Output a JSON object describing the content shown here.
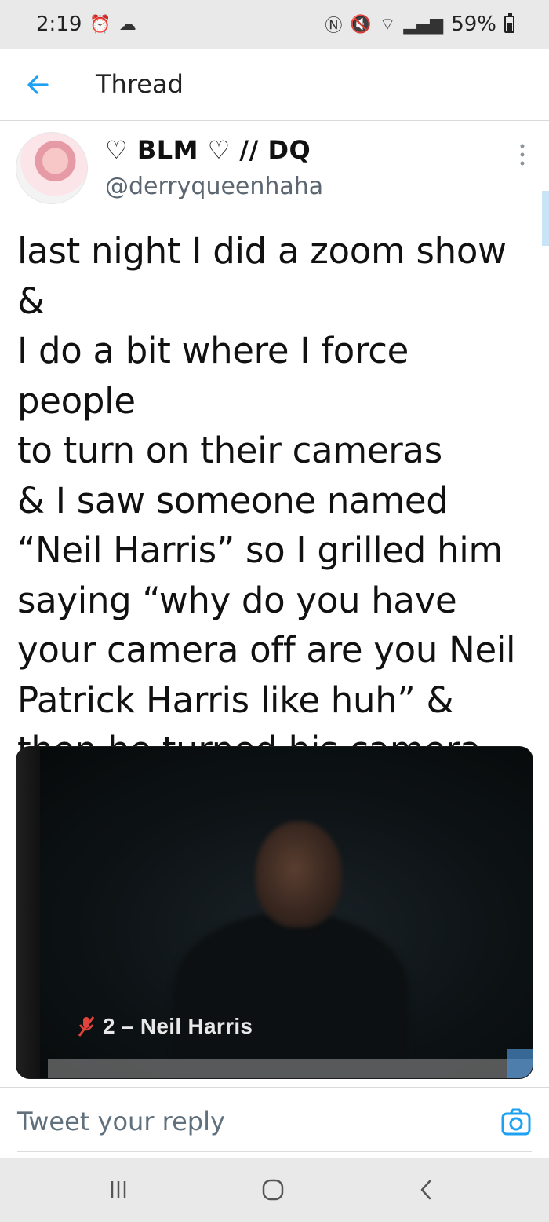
{
  "status_bar": {
    "time": "2:19",
    "battery": "59%"
  },
  "header": {
    "title": "Thread"
  },
  "tweet": {
    "display_name": "♡ BLM ♡ // DQ",
    "handle": "@derryqueenhaha",
    "text": "last night I did a zoom show &\nI do a bit where I force people\nto turn on their cameras\n& I saw someone named\n“Neil Harris” so I grilled him\nsaying “why do you have\nyour camera off are you Neil\nPatrick Harris like huh” &\nthen he turned his camera on\n& it was Neil Patrick Harris",
    "media_caption": "2 – Neil Harris"
  },
  "reply": {
    "placeholder": "Tweet your reply"
  },
  "colors": {
    "accent": "#1da1f2",
    "status_bar_bg": "#e9e9e9",
    "muted_text": "#5b6670"
  },
  "icons": {
    "back": "back-arrow-icon",
    "more": "more-vertical-icon",
    "camera": "camera-icon",
    "mic_muted": "mic-muted-icon"
  }
}
